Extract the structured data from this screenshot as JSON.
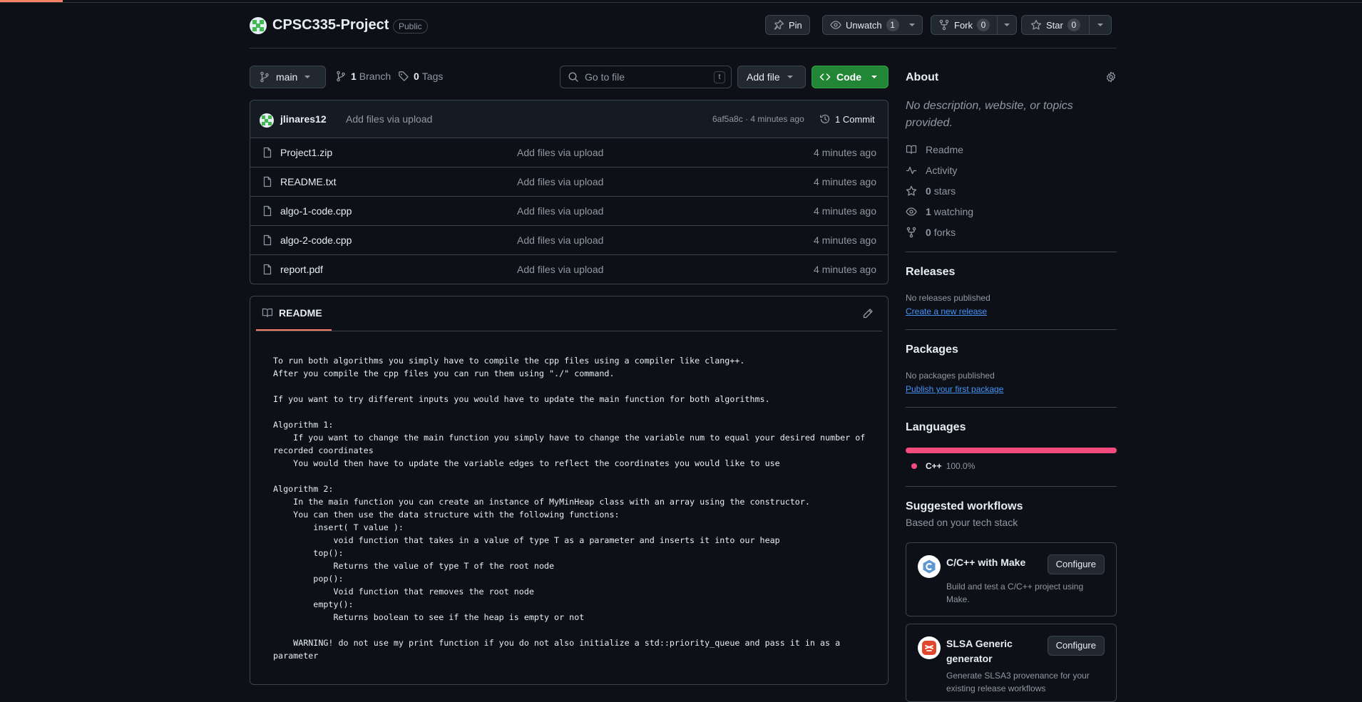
{
  "repo": {
    "name": "CPSC335-Project",
    "visibility": "Public"
  },
  "actions": {
    "pin": "Pin",
    "unwatch": "Unwatch",
    "watch_count": "1",
    "fork": "Fork",
    "fork_count": "0",
    "star": "Star",
    "star_count": "0"
  },
  "branchbar": {
    "branch": "main",
    "branches_count": "1",
    "branches_label": "Branch",
    "tags_count": "0",
    "tags_label": "Tags",
    "search_placeholder": "Go to file",
    "search_shortcut": "t",
    "add_file": "Add file",
    "code": "Code"
  },
  "commit": {
    "author": "jlinares12",
    "message": "Add files via upload",
    "meta": "6af5a8c · 4 minutes ago",
    "count_label": "1 Commit"
  },
  "files": [
    {
      "name": "Project1.zip",
      "message": "Add files via upload",
      "time": "4 minutes ago"
    },
    {
      "name": "README.txt",
      "message": "Add files via upload",
      "time": "4 minutes ago"
    },
    {
      "name": "algo-1-code.cpp",
      "message": "Add files via upload",
      "time": "4 minutes ago"
    },
    {
      "name": "algo-2-code.cpp",
      "message": "Add files via upload",
      "time": "4 minutes ago"
    },
    {
      "name": "report.pdf",
      "message": "Add files via upload",
      "time": "4 minutes ago"
    }
  ],
  "readme": {
    "tab": "README",
    "content": "To run both algorithms you simply have to compile the cpp files using a compiler like clang++.\nAfter you compile the cpp files you can run them using \"./\" command.\n\nIf you want to try different inputs you would have to update the main function for both algorithms.\n\nAlgorithm 1:\n    If you want to change the main function you simply have to change the variable num to equal your desired number of recorded coordinates\n    You would then have to update the variable edges to reflect the coordinates you would like to use\n\nAlgorithm 2:\n    In the main function you can create an instance of MyMinHeap class with an array using the constructor.\n    You can then use the data structure with the following functions:\n        insert( T value ):\n            void function that takes in a value of type T as a parameter and inserts it into our heap\n        top():\n            Returns the value of type T of the root node\n        pop():\n            Void function that removes the root node\n        empty():\n            Returns boolean to see if the heap is empty or not\n\n    WARNING! do not use my print function if you do not also initialize a std::priority_queue and pass it in as a parameter"
  },
  "about": {
    "title": "About",
    "description": "No description, website, or topics provided.",
    "readme": "Readme",
    "activity": "Activity",
    "stars_count": "0",
    "stars_label": "stars",
    "watching_count": "1",
    "watching_label": "watching",
    "forks_count": "0",
    "forks_label": "forks"
  },
  "releases": {
    "title": "Releases",
    "status": "No releases published",
    "link": "Create a new release"
  },
  "packages": {
    "title": "Packages",
    "status": "No packages published",
    "link": "Publish your first package"
  },
  "languages": {
    "title": "Languages",
    "name": "C++",
    "percent": "100.0%",
    "color": "#f34b7d"
  },
  "workflows": {
    "title": "Suggested workflows",
    "subtitle": "Based on your tech stack",
    "items": [
      {
        "title": "C/C++ with Make",
        "description": "Build and test a C/C++ project using Make.",
        "button": "Configure"
      },
      {
        "title": "SLSA Generic generator",
        "description": "Generate SLSA3 provenance for your existing release workflows",
        "button": "Configure"
      }
    ]
  },
  "colors": {
    "accent": "#f78166",
    "green": "#238636",
    "link": "#4493f8",
    "background": "#0d1117"
  }
}
